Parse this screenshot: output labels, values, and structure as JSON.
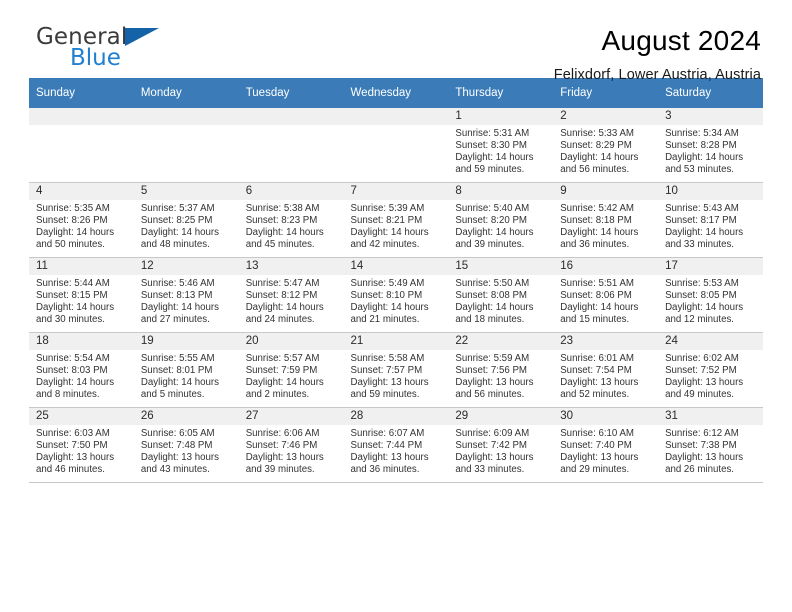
{
  "brand": {
    "line1": "General",
    "line2": "Blue",
    "flag_color": "#1462a8",
    "line2_color": "#1f7fd1"
  },
  "header": {
    "title": "August 2024",
    "location": "Felixdorf, Lower Austria, Austria"
  },
  "theme": {
    "header_bg": "#3b7cb8",
    "daynum_bg": "#f0f0f0",
    "row_border": "#c8c8c8"
  },
  "weekdays": [
    "Sunday",
    "Monday",
    "Tuesday",
    "Wednesday",
    "Thursday",
    "Friday",
    "Saturday"
  ],
  "weeks": [
    [
      {
        "day": ""
      },
      {
        "day": ""
      },
      {
        "day": ""
      },
      {
        "day": ""
      },
      {
        "day": "1",
        "sunrise": "Sunrise: 5:31 AM",
        "sunset": "Sunset: 8:30 PM",
        "daylight1": "Daylight: 14 hours",
        "daylight2": "and 59 minutes."
      },
      {
        "day": "2",
        "sunrise": "Sunrise: 5:33 AM",
        "sunset": "Sunset: 8:29 PM",
        "daylight1": "Daylight: 14 hours",
        "daylight2": "and 56 minutes."
      },
      {
        "day": "3",
        "sunrise": "Sunrise: 5:34 AM",
        "sunset": "Sunset: 8:28 PM",
        "daylight1": "Daylight: 14 hours",
        "daylight2": "and 53 minutes."
      }
    ],
    [
      {
        "day": "4",
        "sunrise": "Sunrise: 5:35 AM",
        "sunset": "Sunset: 8:26 PM",
        "daylight1": "Daylight: 14 hours",
        "daylight2": "and 50 minutes."
      },
      {
        "day": "5",
        "sunrise": "Sunrise: 5:37 AM",
        "sunset": "Sunset: 8:25 PM",
        "daylight1": "Daylight: 14 hours",
        "daylight2": "and 48 minutes."
      },
      {
        "day": "6",
        "sunrise": "Sunrise: 5:38 AM",
        "sunset": "Sunset: 8:23 PM",
        "daylight1": "Daylight: 14 hours",
        "daylight2": "and 45 minutes."
      },
      {
        "day": "7",
        "sunrise": "Sunrise: 5:39 AM",
        "sunset": "Sunset: 8:21 PM",
        "daylight1": "Daylight: 14 hours",
        "daylight2": "and 42 minutes."
      },
      {
        "day": "8",
        "sunrise": "Sunrise: 5:40 AM",
        "sunset": "Sunset: 8:20 PM",
        "daylight1": "Daylight: 14 hours",
        "daylight2": "and 39 minutes."
      },
      {
        "day": "9",
        "sunrise": "Sunrise: 5:42 AM",
        "sunset": "Sunset: 8:18 PM",
        "daylight1": "Daylight: 14 hours",
        "daylight2": "and 36 minutes."
      },
      {
        "day": "10",
        "sunrise": "Sunrise: 5:43 AM",
        "sunset": "Sunset: 8:17 PM",
        "daylight1": "Daylight: 14 hours",
        "daylight2": "and 33 minutes."
      }
    ],
    [
      {
        "day": "11",
        "sunrise": "Sunrise: 5:44 AM",
        "sunset": "Sunset: 8:15 PM",
        "daylight1": "Daylight: 14 hours",
        "daylight2": "and 30 minutes."
      },
      {
        "day": "12",
        "sunrise": "Sunrise: 5:46 AM",
        "sunset": "Sunset: 8:13 PM",
        "daylight1": "Daylight: 14 hours",
        "daylight2": "and 27 minutes."
      },
      {
        "day": "13",
        "sunrise": "Sunrise: 5:47 AM",
        "sunset": "Sunset: 8:12 PM",
        "daylight1": "Daylight: 14 hours",
        "daylight2": "and 24 minutes."
      },
      {
        "day": "14",
        "sunrise": "Sunrise: 5:49 AM",
        "sunset": "Sunset: 8:10 PM",
        "daylight1": "Daylight: 14 hours",
        "daylight2": "and 21 minutes."
      },
      {
        "day": "15",
        "sunrise": "Sunrise: 5:50 AM",
        "sunset": "Sunset: 8:08 PM",
        "daylight1": "Daylight: 14 hours",
        "daylight2": "and 18 minutes."
      },
      {
        "day": "16",
        "sunrise": "Sunrise: 5:51 AM",
        "sunset": "Sunset: 8:06 PM",
        "daylight1": "Daylight: 14 hours",
        "daylight2": "and 15 minutes."
      },
      {
        "day": "17",
        "sunrise": "Sunrise: 5:53 AM",
        "sunset": "Sunset: 8:05 PM",
        "daylight1": "Daylight: 14 hours",
        "daylight2": "and 12 minutes."
      }
    ],
    [
      {
        "day": "18",
        "sunrise": "Sunrise: 5:54 AM",
        "sunset": "Sunset: 8:03 PM",
        "daylight1": "Daylight: 14 hours",
        "daylight2": "and 8 minutes."
      },
      {
        "day": "19",
        "sunrise": "Sunrise: 5:55 AM",
        "sunset": "Sunset: 8:01 PM",
        "daylight1": "Daylight: 14 hours",
        "daylight2": "and 5 minutes."
      },
      {
        "day": "20",
        "sunrise": "Sunrise: 5:57 AM",
        "sunset": "Sunset: 7:59 PM",
        "daylight1": "Daylight: 14 hours",
        "daylight2": "and 2 minutes."
      },
      {
        "day": "21",
        "sunrise": "Sunrise: 5:58 AM",
        "sunset": "Sunset: 7:57 PM",
        "daylight1": "Daylight: 13 hours",
        "daylight2": "and 59 minutes."
      },
      {
        "day": "22",
        "sunrise": "Sunrise: 5:59 AM",
        "sunset": "Sunset: 7:56 PM",
        "daylight1": "Daylight: 13 hours",
        "daylight2": "and 56 minutes."
      },
      {
        "day": "23",
        "sunrise": "Sunrise: 6:01 AM",
        "sunset": "Sunset: 7:54 PM",
        "daylight1": "Daylight: 13 hours",
        "daylight2": "and 52 minutes."
      },
      {
        "day": "24",
        "sunrise": "Sunrise: 6:02 AM",
        "sunset": "Sunset: 7:52 PM",
        "daylight1": "Daylight: 13 hours",
        "daylight2": "and 49 minutes."
      }
    ],
    [
      {
        "day": "25",
        "sunrise": "Sunrise: 6:03 AM",
        "sunset": "Sunset: 7:50 PM",
        "daylight1": "Daylight: 13 hours",
        "daylight2": "and 46 minutes."
      },
      {
        "day": "26",
        "sunrise": "Sunrise: 6:05 AM",
        "sunset": "Sunset: 7:48 PM",
        "daylight1": "Daylight: 13 hours",
        "daylight2": "and 43 minutes."
      },
      {
        "day": "27",
        "sunrise": "Sunrise: 6:06 AM",
        "sunset": "Sunset: 7:46 PM",
        "daylight1": "Daylight: 13 hours",
        "daylight2": "and 39 minutes."
      },
      {
        "day": "28",
        "sunrise": "Sunrise: 6:07 AM",
        "sunset": "Sunset: 7:44 PM",
        "daylight1": "Daylight: 13 hours",
        "daylight2": "and 36 minutes."
      },
      {
        "day": "29",
        "sunrise": "Sunrise: 6:09 AM",
        "sunset": "Sunset: 7:42 PM",
        "daylight1": "Daylight: 13 hours",
        "daylight2": "and 33 minutes."
      },
      {
        "day": "30",
        "sunrise": "Sunrise: 6:10 AM",
        "sunset": "Sunset: 7:40 PM",
        "daylight1": "Daylight: 13 hours",
        "daylight2": "and 29 minutes."
      },
      {
        "day": "31",
        "sunrise": "Sunrise: 6:12 AM",
        "sunset": "Sunset: 7:38 PM",
        "daylight1": "Daylight: 13 hours",
        "daylight2": "and 26 minutes."
      }
    ]
  ]
}
